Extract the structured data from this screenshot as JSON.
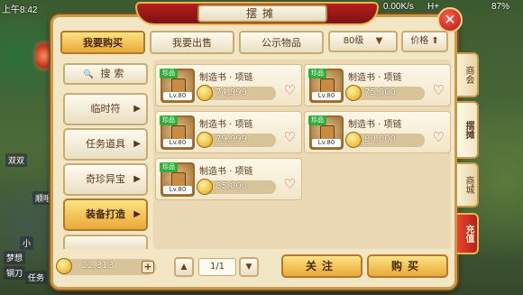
{
  "status_bar": {
    "time": "上午8:42",
    "net_speed": "0.00K/s",
    "signal": "H+",
    "battery": "87%"
  },
  "background_labels": [
    "双双",
    "小",
    "顺哦",
    "梦想",
    "钢刀",
    "任务"
  ],
  "panel": {
    "title": "摆摊"
  },
  "tabs": [
    {
      "label": "我要购买",
      "active": true
    },
    {
      "label": "我要出售",
      "active": false
    },
    {
      "label": "公示物品",
      "active": false
    }
  ],
  "filters": {
    "level": "80级",
    "level_arrow": "▼",
    "price_sort": "价格",
    "price_arrow": "⬆"
  },
  "search": {
    "icon": "🔍",
    "label": "搜索"
  },
  "categories": [
    {
      "label": "临时符",
      "active": false
    },
    {
      "label": "任务道具",
      "active": false
    },
    {
      "label": "奇珍异宝",
      "active": false
    },
    {
      "label": "装备打造",
      "active": true
    }
  ],
  "items": [
    {
      "name": "制造书 · 项链",
      "price": "74,999",
      "tag": "珍品",
      "level": "Lv.80"
    },
    {
      "name": "制造书 · 项链",
      "price": "75,000",
      "tag": "珍品",
      "level": "Lv.80"
    },
    {
      "name": "制造书 · 项链",
      "price": "79,999",
      "tag": "珍品",
      "level": "Lv.80"
    },
    {
      "name": "制造书 · 项链",
      "price": "80,000",
      "tag": "珍品",
      "level": "Lv.80"
    },
    {
      "name": "制造书 · 项链",
      "price": "85,000",
      "tag": "珍品",
      "level": "Lv.80"
    }
  ],
  "wallet": {
    "amount": "22,313",
    "plus": "+"
  },
  "pagination": {
    "prev": "▲",
    "next": "▼",
    "page": "1/1"
  },
  "actions": {
    "follow": "关注",
    "buy": "购买"
  },
  "side_tabs": [
    {
      "label": "商会",
      "active": false
    },
    {
      "label": "摆摊",
      "active": true
    },
    {
      "label": "商城",
      "active": false
    },
    {
      "label": "充值",
      "active": false
    }
  ],
  "close": "✕",
  "colors": {
    "accent": "#e9a93a",
    "panel": "#f3e6c5",
    "border": "#c99a4a",
    "red": "#b51f1f"
  }
}
